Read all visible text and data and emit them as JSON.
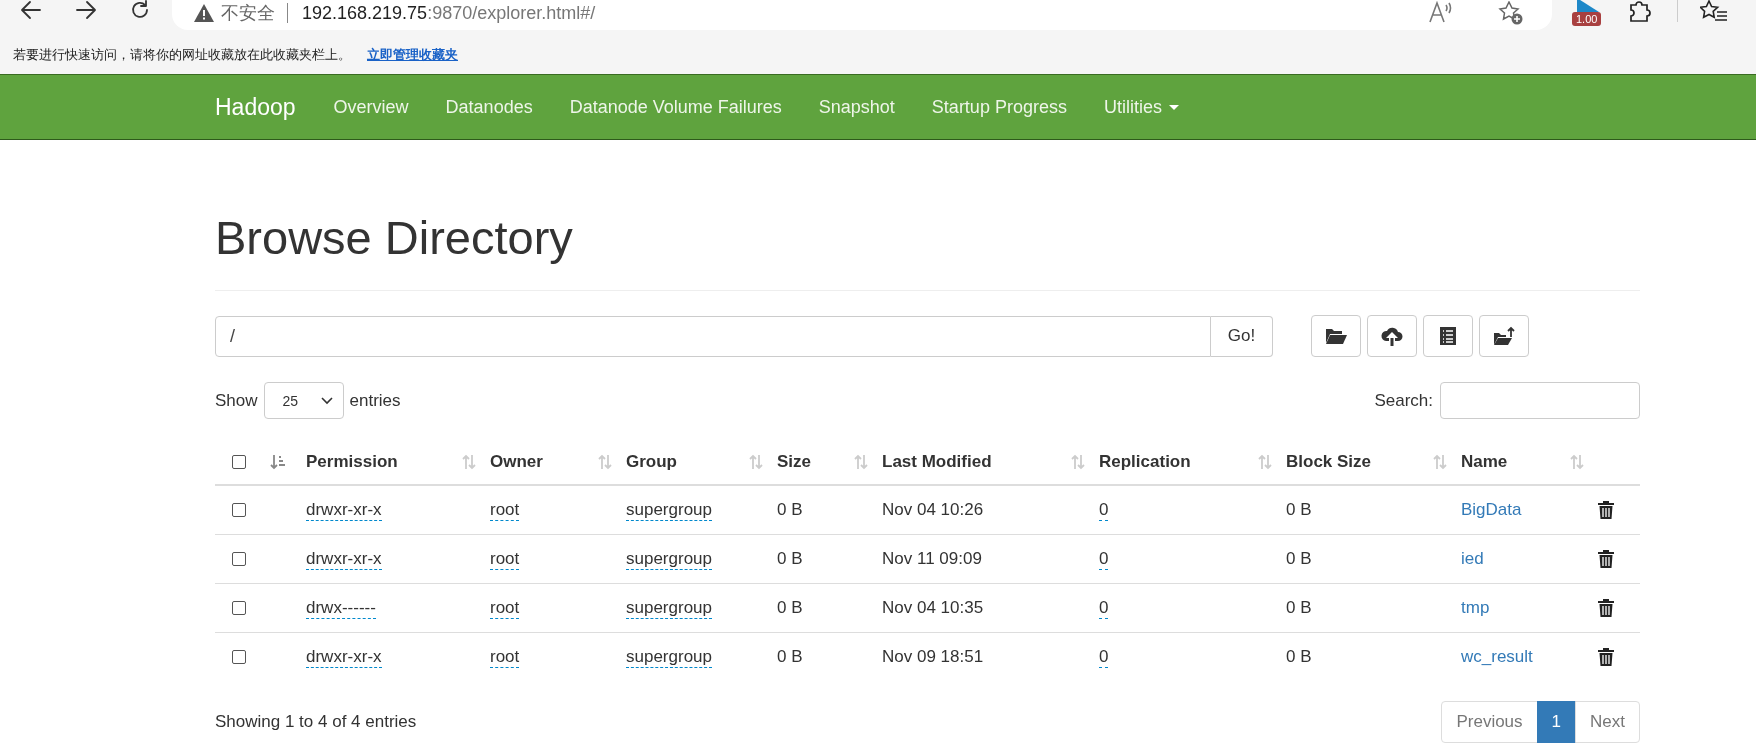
{
  "browser": {
    "security_label": "不安全",
    "url_host": "192.168.219.75",
    "url_rest": ":9870/explorer.html#/",
    "extension_badge": "1.00"
  },
  "bookmarks_hint": {
    "text": "若要进行快速访问，请将你的网址收藏放在此收藏夹栏上。",
    "link": "立即管理收藏夹"
  },
  "navbar": {
    "brand": "Hadoop",
    "items": [
      {
        "label": "Overview",
        "has_menu": false
      },
      {
        "label": "Datanodes",
        "has_menu": false
      },
      {
        "label": "Datanode Volume Failures",
        "has_menu": false
      },
      {
        "label": "Snapshot",
        "has_menu": false
      },
      {
        "label": "Startup Progress",
        "has_menu": false
      },
      {
        "label": "Utilities",
        "has_menu": true
      }
    ]
  },
  "title": "Browse Directory",
  "path_field": {
    "value": "/"
  },
  "go_button": "Go!",
  "length": {
    "before": "Show",
    "value": "25",
    "after": "entries"
  },
  "search": {
    "label": "Search:"
  },
  "table": {
    "select_all_checked": false,
    "order_sorted": true,
    "columns": [
      {
        "label": "Permission",
        "sorted": false
      },
      {
        "label": "Owner",
        "sorted": false
      },
      {
        "label": "Group",
        "sorted": false
      },
      {
        "label": "Size",
        "sorted": false
      },
      {
        "label": "Last Modified",
        "sorted": false
      },
      {
        "label": "Replication",
        "sorted": false
      },
      {
        "label": "Block Size",
        "sorted": false
      },
      {
        "label": "Name",
        "sorted": false
      }
    ],
    "rows": [
      {
        "checked": false,
        "permission": "drwxr-xr-x",
        "owner": "root",
        "group": "supergroup",
        "size": "0 B",
        "last_modified": "Nov 04 10:26",
        "replication": "0",
        "block_size": "0 B",
        "name": "BigData"
      },
      {
        "checked": false,
        "permission": "drwxr-xr-x",
        "owner": "root",
        "group": "supergroup",
        "size": "0 B",
        "last_modified": "Nov 11 09:09",
        "replication": "0",
        "block_size": "0 B",
        "name": "ied"
      },
      {
        "checked": false,
        "permission": "drwx------",
        "owner": "root",
        "group": "supergroup",
        "size": "0 B",
        "last_modified": "Nov 04 10:35",
        "replication": "0",
        "block_size": "0 B",
        "name": "tmp"
      },
      {
        "checked": false,
        "permission": "drwxr-xr-x",
        "owner": "root",
        "group": "supergroup",
        "size": "0 B",
        "last_modified": "Nov 09 18:51",
        "replication": "0",
        "block_size": "0 B",
        "name": "wc_result"
      }
    ]
  },
  "info": "Showing 1 to 4 of 4 entries",
  "pagination": [
    {
      "label": "Previous",
      "kind": "prev",
      "selected": false
    },
    {
      "label": "1",
      "kind": "page",
      "selected": true
    },
    {
      "label": "Next",
      "kind": "next",
      "selected": false
    }
  ]
}
